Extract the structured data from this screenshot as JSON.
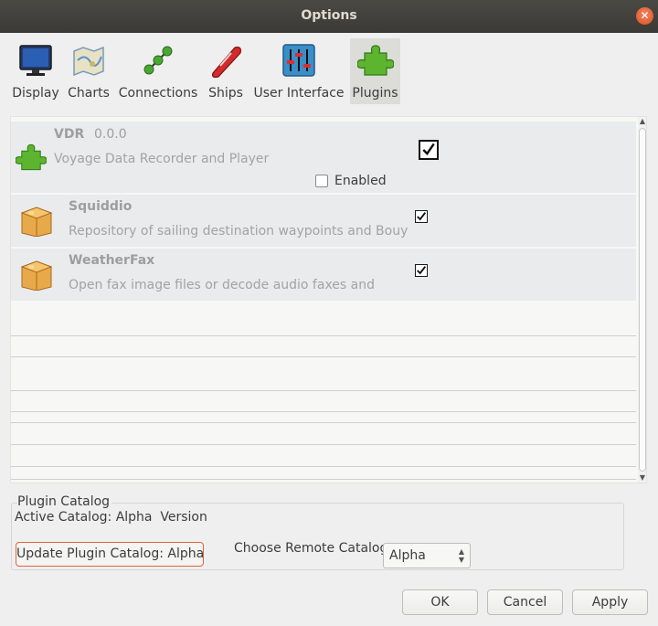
{
  "window": {
    "title": "Options"
  },
  "toolbar": {
    "items": [
      {
        "label": "Display",
        "icon": "display-icon"
      },
      {
        "label": "Charts",
        "icon": "charts-icon"
      },
      {
        "label": "Connections",
        "icon": "connections-icon"
      },
      {
        "label": "Ships",
        "icon": "ships-icon"
      },
      {
        "label": "User Interface",
        "icon": "user-interface-icon"
      },
      {
        "label": "Plugins",
        "icon": "plugins-icon"
      }
    ],
    "active": "Plugins"
  },
  "plugins": [
    {
      "name": "VDR",
      "version": "0.0.0",
      "description": "Voyage Data Recorder and Player",
      "checked": true,
      "enabled_label": "Enabled",
      "icon": "puzzle-icon"
    },
    {
      "name": "Squiddio",
      "description": "Repository of sailing destination waypoints and Bouy",
      "checked": true,
      "icon": "package-icon"
    },
    {
      "name": "WeatherFax",
      "description": "Open fax image files or decode audio faxes and",
      "checked": true,
      "icon": "package-icon"
    }
  ],
  "catalog": {
    "legend": "Plugin Catalog",
    "active_catalog": "Active Catalog: Alpha  Version",
    "update_button": "Update Plugin Catalog: Alpha",
    "remote_label": "Choose Remote Catalog",
    "remote_value": "Alpha"
  },
  "buttons": {
    "ok": "OK",
    "cancel": "Cancel",
    "apply": "Apply"
  },
  "colors": {
    "accent": "#e2643b",
    "titlebar": "#3c3b37",
    "row_bg": "#e9ebed"
  }
}
